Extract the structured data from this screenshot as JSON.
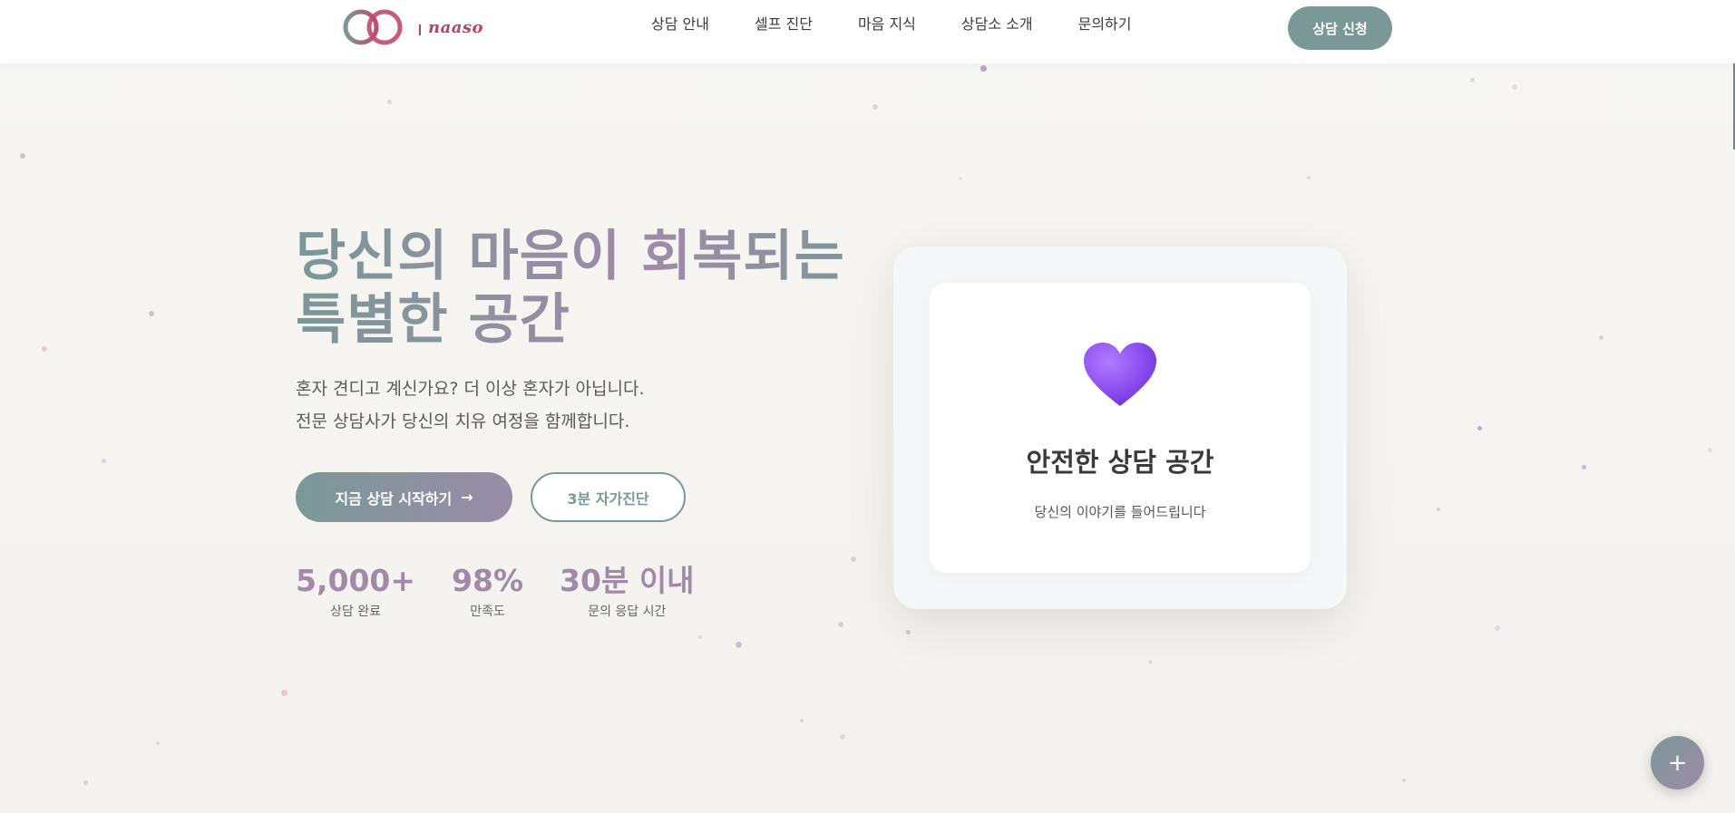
{
  "header": {
    "logo_text": "naaso",
    "nav": [
      "상담 안내",
      "셀프 진단",
      "마음 지식",
      "상담소 소개",
      "문의하기"
    ],
    "cta_label": "상담 신청"
  },
  "hero": {
    "title_line1": "당신의 마음이 회복되는",
    "title_line2": "특별한 공간",
    "subtitle_line1": "혼자 견디고 계신가요? 더 이상 혼자가 아닙니다.",
    "subtitle_line2": "전문 상담사가 당신의 치유 여정을 함께합니다.",
    "primary_button": "지금 상담 시작하기",
    "primary_button_icon": "arrow-right-icon",
    "secondary_button": "3분 자가진단",
    "stats": [
      {
        "value": "5,000+",
        "label": "상담 완료"
      },
      {
        "value": "98%",
        "label": "만족도"
      },
      {
        "value": "30분 이내",
        "label": "문의 응답 시간"
      }
    ]
  },
  "card": {
    "icon": "heart-icon",
    "title": "안전한 상담 공간",
    "description": "당신의 이야기를 들어드립니다"
  },
  "fab": {
    "label": "+",
    "icon": "plus-icon"
  },
  "colors": {
    "accent": "#7a9896",
    "secondary_accent": "#a08aa8",
    "heart": "#8b4cf0",
    "logo": "#b0446a",
    "background": "#f6f5f2"
  }
}
